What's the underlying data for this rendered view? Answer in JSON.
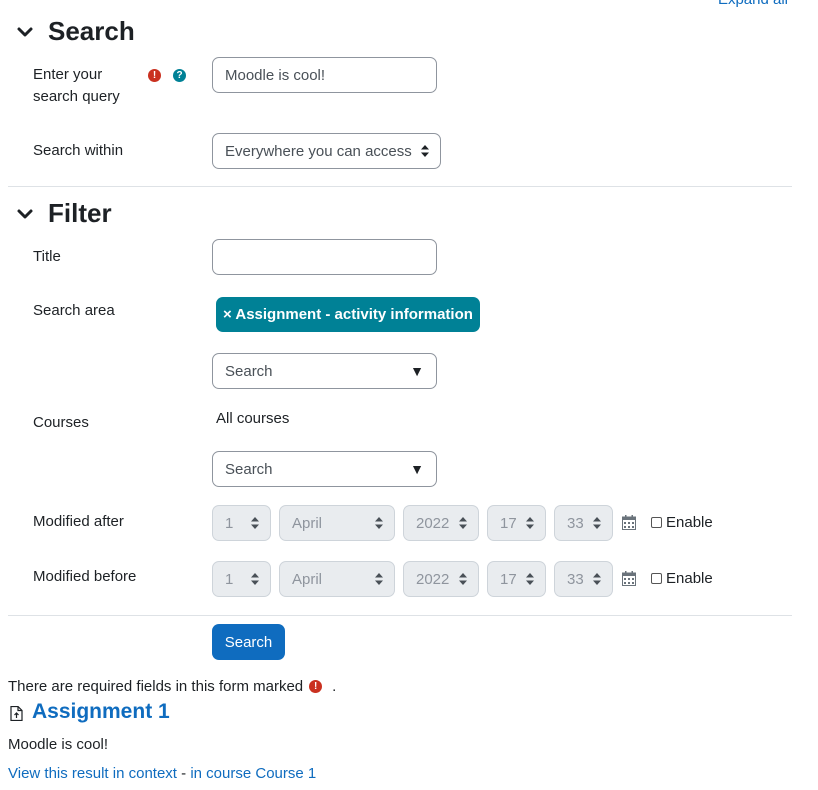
{
  "header": {
    "expand_all": "Expand all"
  },
  "search_section": {
    "title": "Search",
    "query_label_line1": "Enter your",
    "query_label_line2": "search query",
    "query_value": "Moodle is cool!",
    "within_label": "Search within",
    "within_value": "Everywhere you can access"
  },
  "filter_section": {
    "title": "Filter",
    "title_label": "Title",
    "title_value": "",
    "area_label": "Search area",
    "area_chip": "× Assignment - activity information",
    "area_search_placeholder": "Search",
    "courses_label": "Courses",
    "courses_value": "All courses",
    "courses_search_placeholder": "Search",
    "modified_after": {
      "label": "Modified after",
      "day": "1",
      "month": "April",
      "year": "2022",
      "hour": "17",
      "minute": "33",
      "enable_label": "Enable"
    },
    "modified_before": {
      "label": "Modified before",
      "day": "1",
      "month": "April",
      "year": "2022",
      "hour": "17",
      "minute": "33",
      "enable_label": "Enable"
    }
  },
  "submit_label": "Search",
  "required_note": "There are required fields in this form marked",
  "required_note_end": ".",
  "result": {
    "title": "Assignment 1",
    "snippet": "Moodle is cool!",
    "view_link": "View this result in context",
    "separator": "-",
    "course_link": "in course Course 1"
  },
  "colors": {
    "primary": "#0f6cbf",
    "chip": "#008196",
    "required": "#ca3120",
    "help": "#008196"
  },
  "icons": {
    "collapse": "chevron-down-icon",
    "required": "exclamation-circle-icon",
    "help": "question-circle-icon",
    "calendar": "calendar-icon",
    "result": "file-icon"
  }
}
